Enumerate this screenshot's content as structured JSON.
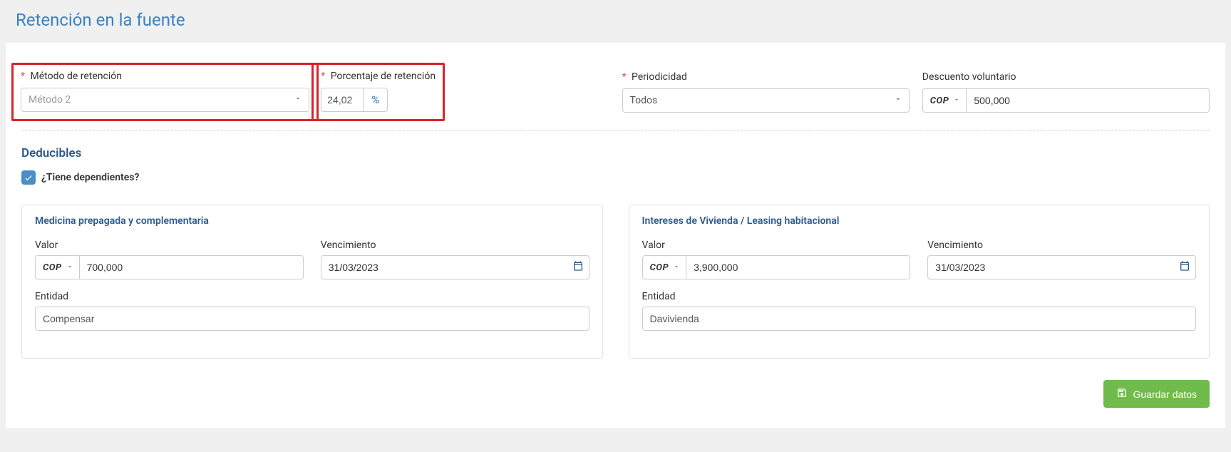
{
  "page": {
    "title": "Retención en la fuente"
  },
  "top": {
    "metodo": {
      "label": "Método de retención",
      "value": "Método 2"
    },
    "porcentaje": {
      "label": "Porcentaje de retención",
      "value": "24,02",
      "unit": "%"
    },
    "periodicidad": {
      "label": "Periodicidad",
      "value": "Todos"
    },
    "descuento": {
      "label": "Descuento voluntario",
      "currency": "COP",
      "value": "500,000"
    }
  },
  "deducibles": {
    "heading": "Deducibles",
    "dependientes": {
      "label": "¿Tiene dependientes?",
      "checked": true
    }
  },
  "medicina": {
    "title": "Medicina prepagada y complementaria",
    "valor": {
      "label": "Valor",
      "currency": "COP",
      "value": "700,000"
    },
    "vencimiento": {
      "label": "Vencimiento",
      "value": "31/03/2023"
    },
    "entidad": {
      "label": "Entidad",
      "value": "Compensar"
    }
  },
  "intereses": {
    "title": "Intereses de Vivienda / Leasing habitacional",
    "valor": {
      "label": "Valor",
      "currency": "COP",
      "value": "3,900,000"
    },
    "vencimiento": {
      "label": "Vencimiento",
      "value": "31/03/2023"
    },
    "entidad": {
      "label": "Entidad",
      "value": "Davivienda"
    }
  },
  "actions": {
    "save": "Guardar datos"
  }
}
